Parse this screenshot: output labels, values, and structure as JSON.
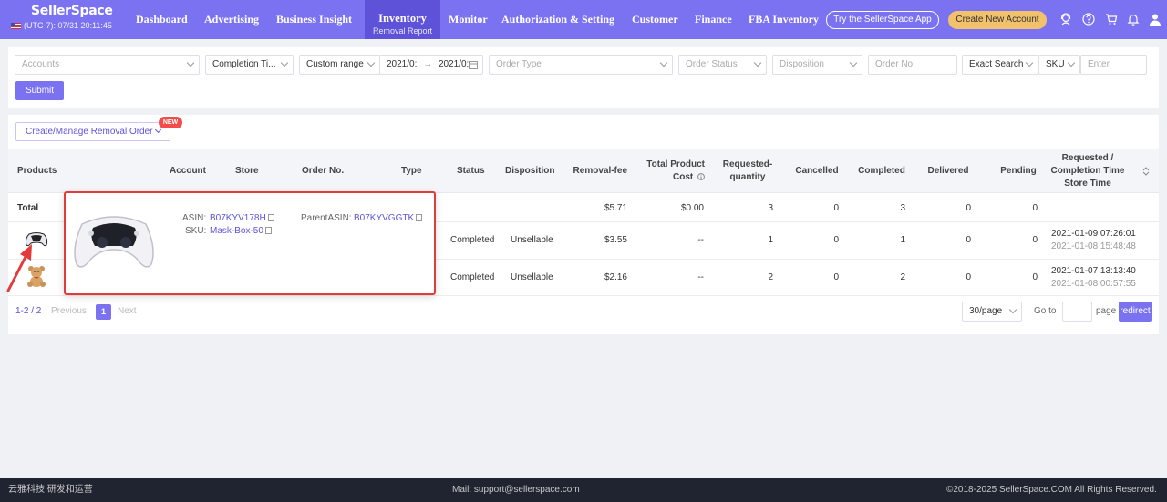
{
  "brand": {
    "name": "SellerSpace",
    "time": "(UTC-7): 07/31 20:11:45"
  },
  "nav": {
    "items": [
      "Dashboard",
      "Advertising",
      "Business Insight",
      "Monitor",
      "Authorization & Setting",
      "Customer",
      "Finance",
      "FBA Inventory"
    ],
    "active_label": "Inventory",
    "active_sub": "Removal Report",
    "app_button": "Try the SellerSpace App",
    "new_account_button": "Create New Account"
  },
  "filters": {
    "accounts_placeholder": "Accounts",
    "completion_time": "Completion Ti...",
    "custom_range": "Custom range",
    "date_start": "2021/0:",
    "date_end": "2021/0:",
    "date_sep": "→",
    "order_type_placeholder": "Order Type",
    "order_status_placeholder": "Order Status",
    "disposition_placeholder": "Disposition",
    "order_no_placeholder": "Order No.",
    "exact_search": "Exact Search",
    "sku_label": "SKU",
    "enter_placeholder": "Enter",
    "submit": "Submit"
  },
  "toolbar": {
    "create_manage": "Create/Manage Removal Order",
    "new_badge": "NEW"
  },
  "table": {
    "headers": {
      "products": "Products",
      "account": "Account",
      "store": "Store",
      "order_no": "Order No.",
      "type": "Type",
      "status": "Status",
      "disposition": "Disposition",
      "removal_fee": "Removal-fee",
      "total_product_cost_1": "Total Product",
      "total_product_cost_2": "Cost",
      "requested_qty_1": "Requested-",
      "requested_qty_2": "quantity",
      "cancelled": "Cancelled",
      "completed": "Completed",
      "delivered": "Delivered",
      "pending": "Pending",
      "req_time_1": "Requested /",
      "req_time_2": "Completion Time",
      "req_time_3": "Store Time"
    },
    "total": {
      "label": "Total",
      "removal_fee": "$5.71",
      "total_cost": "$0.00",
      "requested": "3",
      "cancelled": "0",
      "completed": "3",
      "delivered": "0",
      "pending": "0"
    },
    "rows": [
      {
        "status": "Completed",
        "disposition": "Unsellable",
        "removal_fee": "$3.55",
        "total_cost": "--",
        "requested": "1",
        "cancelled": "0",
        "completed": "1",
        "delivered": "0",
        "pending": "0",
        "requested_time": "2021-01-09 07:26:01",
        "completion_time": "2021-01-08 15:48:48",
        "product_icon": "game-controller-icon"
      },
      {
        "status": "Completed",
        "disposition": "Unsellable",
        "removal_fee": "$2.16",
        "total_cost": "--",
        "requested": "2",
        "cancelled": "0",
        "completed": "2",
        "delivered": "0",
        "pending": "0",
        "requested_time": "2021-01-07 13:13:40",
        "completion_time": "2021-01-08 00:57:55",
        "product_icon": "teddy-bear-icon"
      }
    ]
  },
  "popup": {
    "asin_label": "ASIN:",
    "asin": "B07KYV178H",
    "sku_label": "SKU:",
    "sku": "Mask-Box-50",
    "parent_asin_label": "ParentASIN:",
    "parent_asin": "B07KYVGGTK"
  },
  "pagination": {
    "range": "1-2",
    "separator": "/",
    "total": "2",
    "previous": "Previous",
    "current": "1",
    "next": "Next",
    "page_size": "30/page",
    "go_to": "Go to",
    "page": "page",
    "redirect": "redirect"
  },
  "footer": {
    "left": "云雅科技 研发和运营",
    "mail": "Mail: support@sellerspace.com",
    "copyright": "©2018-2025 SellerSpace.COM All Rights Reserved."
  },
  "colors": {
    "primary": "#7b72f2",
    "active_nav": "#5e52d9",
    "highlight_border": "#e23b3b",
    "accent_button": "#f2c16c",
    "footer_bg": "#1f2430"
  }
}
